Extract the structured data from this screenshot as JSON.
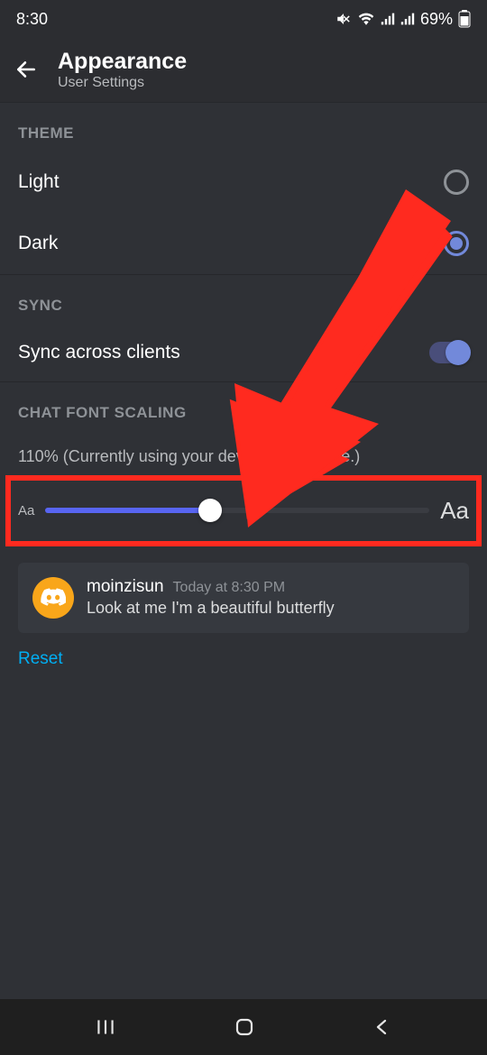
{
  "status": {
    "time": "8:30",
    "battery": "69%"
  },
  "header": {
    "title": "Appearance",
    "subtitle": "User Settings"
  },
  "sections": {
    "theme": {
      "title": "THEME",
      "light": "Light",
      "dark": "Dark",
      "selected": "dark"
    },
    "sync": {
      "title": "SYNC",
      "sync_clients": "Sync across clients",
      "sync_enabled": true
    },
    "font_scaling": {
      "title": "CHAT FONT SCALING",
      "value_text": "110% (Currently using your device's font scale.)",
      "slider_percent": 43,
      "label_small": "Aa",
      "label_large": "Aa"
    }
  },
  "preview": {
    "username": "moinzisun",
    "timestamp": "Today at 8:30 PM",
    "message": "Look at me I'm a beautiful butterfly"
  },
  "reset_label": "Reset",
  "annotation": {
    "arrow_color": "#ff2a1f",
    "highlight_color": "#ff2a1f"
  }
}
